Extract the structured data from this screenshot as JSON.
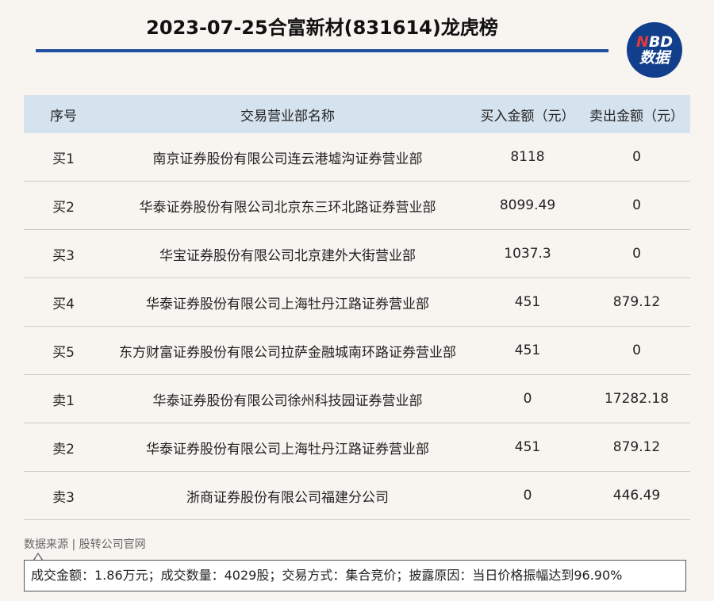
{
  "header": {
    "title": "2023-07-25合富新材(831614)龙虎榜",
    "logo_top": "NBD",
    "logo_bottom": "数据"
  },
  "table": {
    "columns": [
      "序号",
      "交易营业部名称",
      "买入金额（元）",
      "卖出金额（元）"
    ],
    "rows": [
      {
        "seq": "买1",
        "name": "南京证券股份有限公司连云港墟沟证券营业部",
        "buy": "8118",
        "sell": "0"
      },
      {
        "seq": "买2",
        "name": "华泰证券股份有限公司北京东三环北路证券营业部",
        "buy": "8099.49",
        "sell": "0"
      },
      {
        "seq": "买3",
        "name": "华宝证券股份有限公司北京建外大街营业部",
        "buy": "1037.3",
        "sell": "0"
      },
      {
        "seq": "买4",
        "name": "华泰证券股份有限公司上海牡丹江路证券营业部",
        "buy": "451",
        "sell": "879.12"
      },
      {
        "seq": "买5",
        "name": "东方财富证券股份有限公司拉萨金融城南环路证券营业部",
        "buy": "451",
        "sell": "0"
      },
      {
        "seq": "卖1",
        "name": "华泰证券股份有限公司徐州科技园证券营业部",
        "buy": "0",
        "sell": "17282.18"
      },
      {
        "seq": "卖2",
        "name": "华泰证券股份有限公司上海牡丹江路证券营业部",
        "buy": "451",
        "sell": "879.12"
      },
      {
        "seq": "卖3",
        "name": "浙商证券股份有限公司福建分公司",
        "buy": "0",
        "sell": "446.49"
      }
    ]
  },
  "footer": {
    "source": "数据来源 | 股转公司官网",
    "summary": "成交金额：1.86万元；成交数量：4029股；交易方式：集合竞价；披露原因：当日价格振幅达到96.90%"
  },
  "colors": {
    "accent": "#1f4fa0",
    "header_bg": "#d5e3ee",
    "logo_bg": "#123f8c",
    "logo_n": "#e03a3a"
  }
}
